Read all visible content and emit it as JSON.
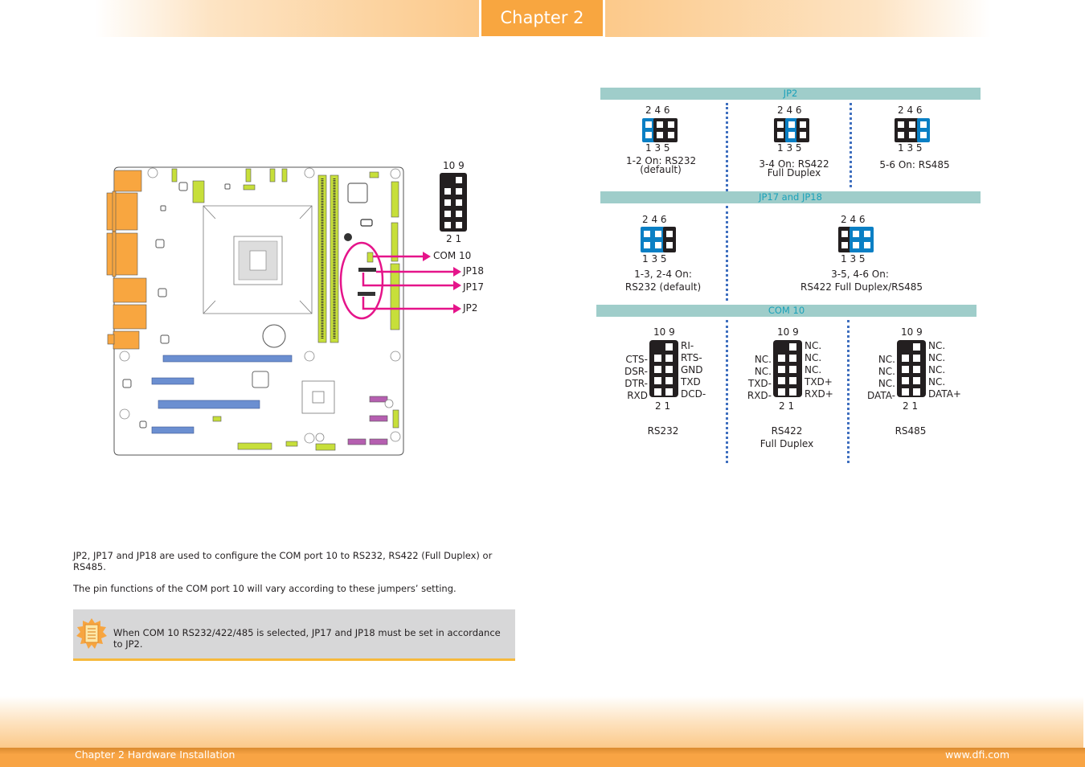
{
  "header": {
    "chapter_tab": "Chapter 2"
  },
  "footer": {
    "left": "Chapter 2 Hardware Installation",
    "right": "www.dfi.com"
  },
  "board": {
    "connector_callouts": [
      "COM 10",
      "JP18",
      "JP17",
      "JP2"
    ],
    "com_header": {
      "top_pins": "10 9",
      "bottom_pins": "2 1"
    },
    "colors": {
      "callout": "#e5148a",
      "connector": "#f8a640",
      "slot": "#6b8fd1",
      "header": "#c7df3a",
      "sata": "#b55fb0"
    }
  },
  "jp2": {
    "title": "JP2",
    "top_pins": "2  4  6",
    "bottom_pins": "1  3  5",
    "settings": [
      {
        "active_pair": 1,
        "line1": "1-2 On: RS232",
        "line2": "(default)"
      },
      {
        "active_pair": 2,
        "line1": "3-4 On: RS422",
        "line2": "Full Duplex"
      },
      {
        "active_pair": 3,
        "line1": "5-6 On: RS485",
        "line2": ""
      }
    ]
  },
  "jp17_18": {
    "title": "JP17 and JP18",
    "top_pins": "2  4  6",
    "bottom_pins": "1  3  5",
    "settings": [
      {
        "active": "1-3, 2-4",
        "line1": "1-3, 2-4 On:",
        "line2": "RS232 (default)"
      },
      {
        "active": "3-5, 4-6",
        "line1": "3-5, 4-6 On:",
        "line2": "RS422 Full Duplex/RS485"
      }
    ]
  },
  "com10": {
    "title": "COM 10",
    "top_pins": "10 9",
    "bottom_pins": "2 1",
    "modes": [
      {
        "name": "RS232",
        "sub": "",
        "left": [
          "",
          "CTS-",
          "DSR-",
          "DTR-",
          "RXD"
        ],
        "right": [
          "RI-",
          "RTS-",
          "GND",
          "TXD",
          "DCD-"
        ]
      },
      {
        "name": "RS422",
        "sub": "Full Duplex",
        "left": [
          "",
          "NC.",
          "NC.",
          "TXD-",
          "RXD-"
        ],
        "right": [
          "NC.",
          "NC.",
          "NC.",
          "TXD+",
          "RXD+"
        ]
      },
      {
        "name": "RS485",
        "sub": "",
        "left": [
          "",
          "NC.",
          "NC.",
          "NC.",
          "DATA-"
        ],
        "right": [
          "NC.",
          "NC.",
          "NC.",
          "NC.",
          "DATA+"
        ]
      }
    ]
  },
  "body": {
    "para1": "JP2, JP17 and JP18 are used to configure the COM port 10 to RS232, RS422 (Full Duplex) or RS485.",
    "para2": "The pin functions of the COM port 10 will vary according to these jumpers’ setting.",
    "note": "When COM 10 RS232/422/485 is selected, JP17 and JP18 must be set in accordance to JP2."
  }
}
